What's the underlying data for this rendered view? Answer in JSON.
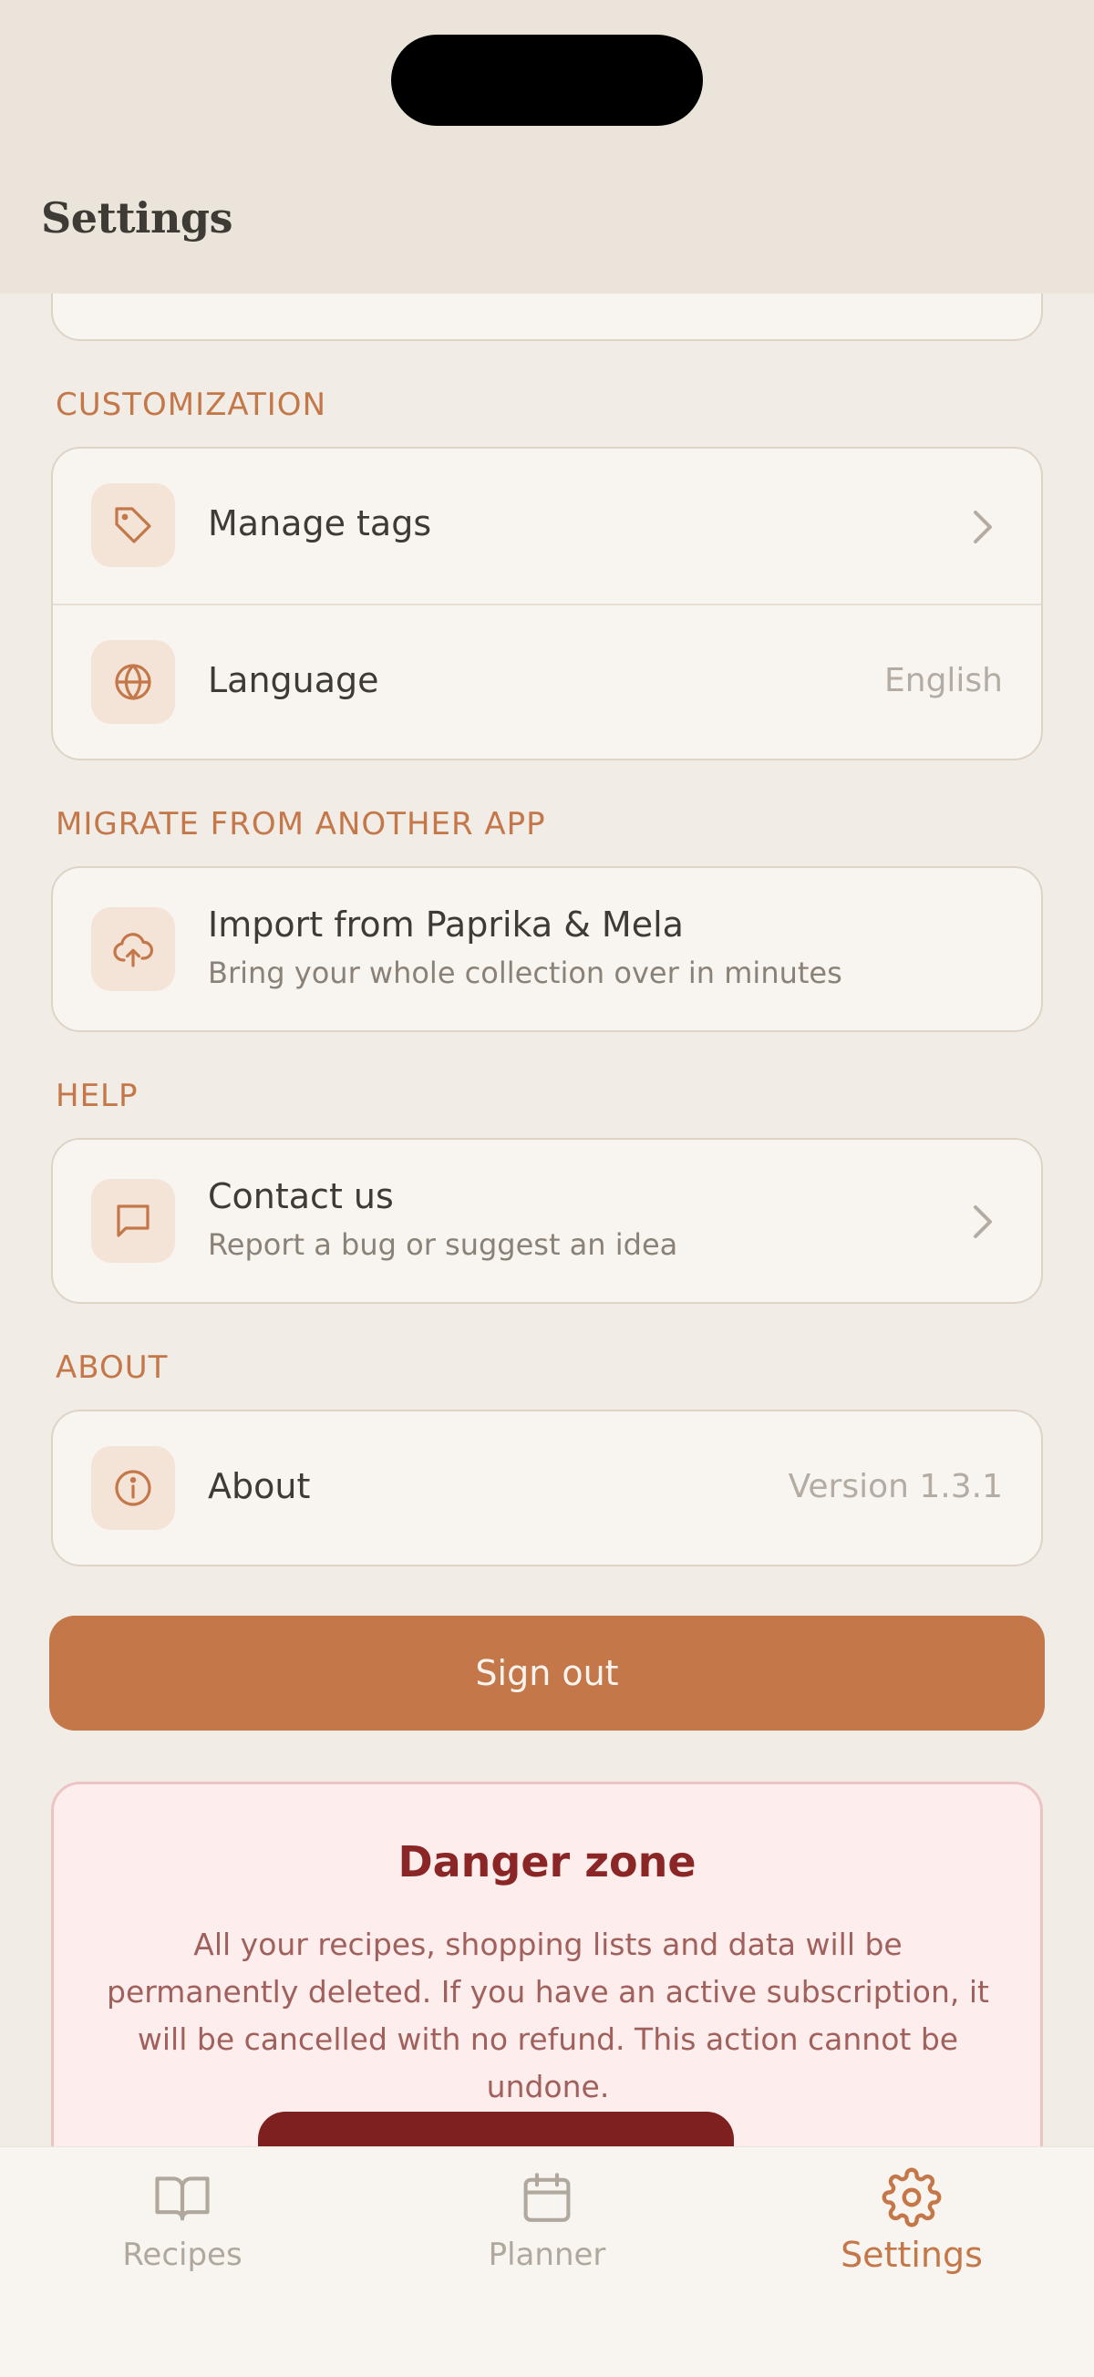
{
  "header": {
    "title": "Settings"
  },
  "sections": {
    "customization": {
      "title": "CUSTOMIZATION",
      "manage_tags": {
        "label": "Manage tags"
      },
      "language": {
        "label": "Language",
        "value": "English"
      }
    },
    "migrate": {
      "title": "MIGRATE FROM ANOTHER APP",
      "import": {
        "label": "Import from Paprika & Mela",
        "subtitle": "Bring your whole collection over in minutes"
      }
    },
    "help": {
      "title": "HELP",
      "contact": {
        "label": "Contact us",
        "subtitle": "Report a bug or suggest an idea"
      }
    },
    "about": {
      "title": "ABOUT",
      "about": {
        "label": "About",
        "value": "Version 1.3.1"
      }
    }
  },
  "sign_out": {
    "label": "Sign out"
  },
  "danger_zone": {
    "title": "Danger zone",
    "text": "All your recipes, shopping lists and data will be permanently deleted. If you have an active subscription, it will be cancelled with no refund. This action cannot be undone."
  },
  "tabbar": {
    "items": [
      {
        "label": "Recipes",
        "icon": "book-icon"
      },
      {
        "label": "Planner",
        "icon": "calendar-icon"
      },
      {
        "label": "Settings",
        "icon": "gear-icon",
        "active": true
      }
    ]
  },
  "colors": {
    "accent": "#c4784a",
    "background": "#f1ece5",
    "danger": "#8b2626"
  }
}
